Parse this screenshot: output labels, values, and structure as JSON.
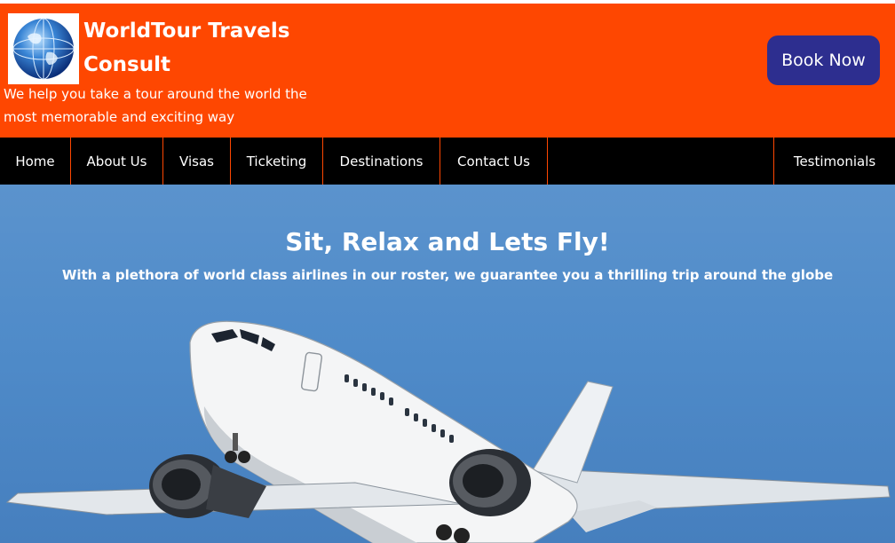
{
  "header": {
    "logo_icon": "globe-icon",
    "brand_title": "WorldTour Travels Consult",
    "tagline": "We help you take a tour around the world the most memorable and exciting way",
    "book_button": "Book Now",
    "colors": {
      "header_bg": "#fe4701",
      "button_bg": "#2d2e8f",
      "nav_bg": "#000000"
    }
  },
  "nav": {
    "items": [
      "Home",
      "About Us",
      "Visas",
      "Ticketing",
      "Destinations",
      "Contact Us",
      "Testimonials"
    ]
  },
  "hero": {
    "title": "Sit, Relax and Lets Fly!",
    "subtitle": "With a plethora of world class airlines in our roster, we guarantee you a thrilling trip around the globe",
    "image": "airplane-photo",
    "colors": {
      "sky": "#4f8bc9"
    }
  }
}
